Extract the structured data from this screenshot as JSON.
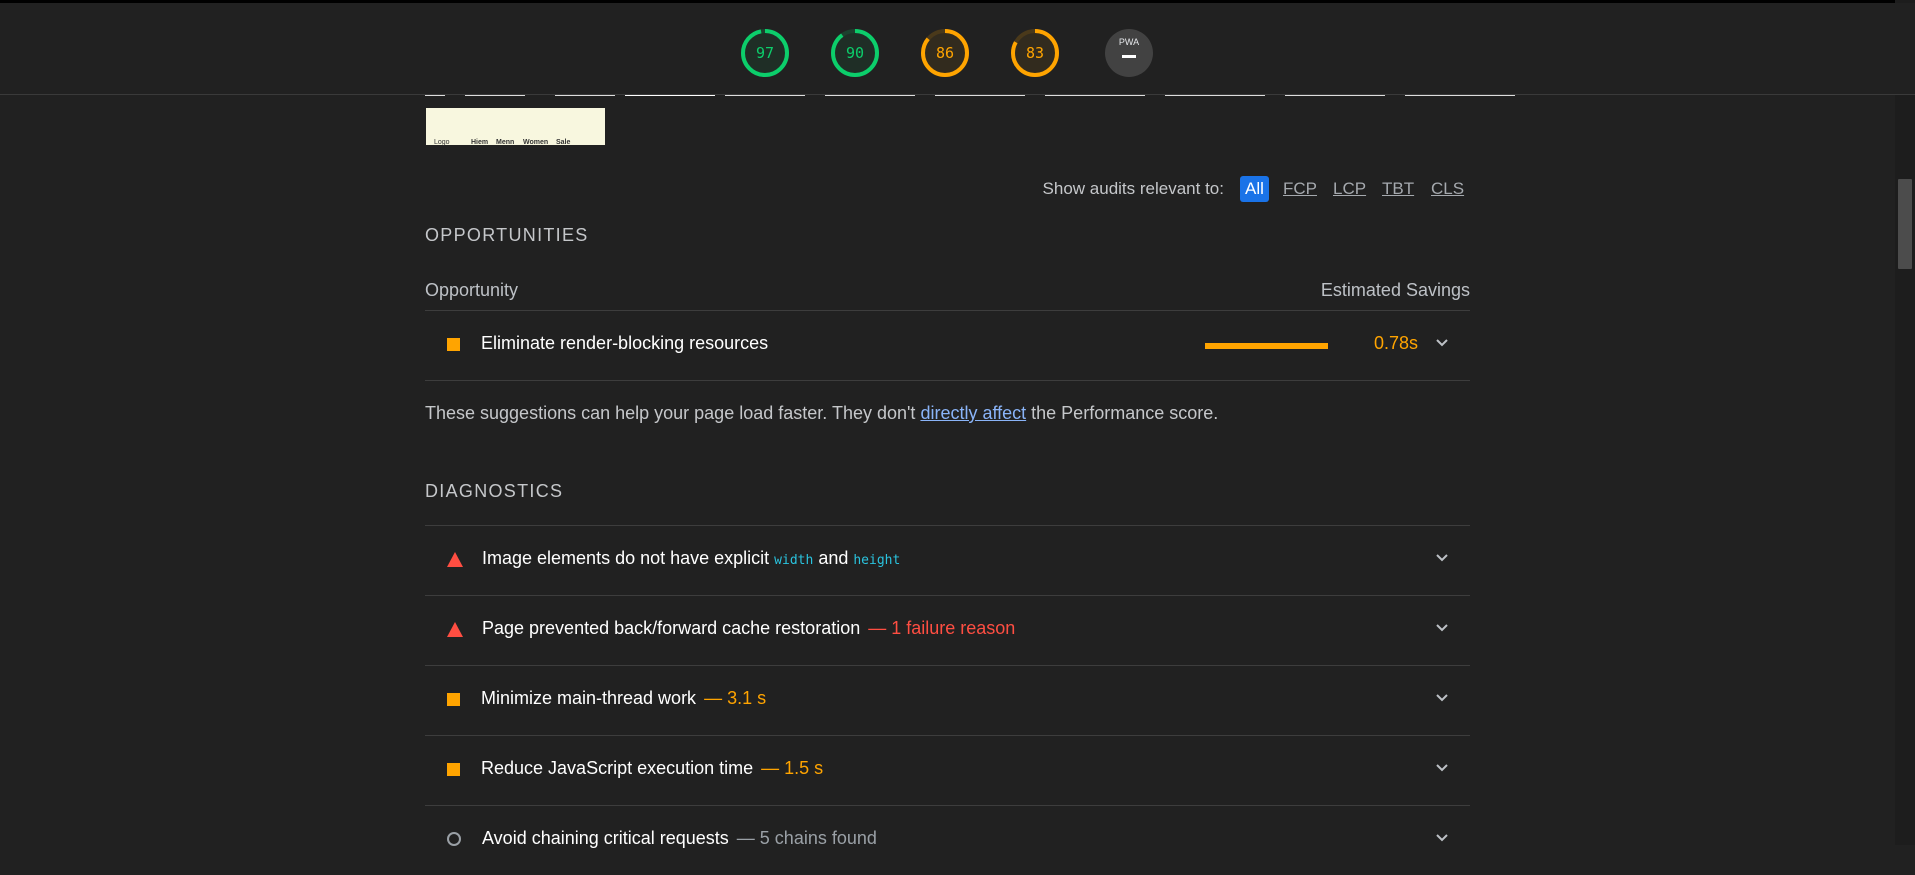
{
  "gauges": [
    {
      "label": "97",
      "score": 0.97,
      "color": "#0cce6b"
    },
    {
      "label": "90",
      "score": 0.9,
      "color": "#0cce6b"
    },
    {
      "label": "86",
      "score": 0.86,
      "color": "#ffa400"
    },
    {
      "label": "83",
      "score": 0.83,
      "color": "#ffa400"
    }
  ],
  "pwa_badge": {
    "label": "PWA"
  },
  "thumbnail": {
    "items": [
      "Logo",
      "Hiem",
      "Menn",
      "Women",
      "Sale"
    ]
  },
  "filter": {
    "label": "Show audits relevant to:",
    "options": [
      "All",
      "FCP",
      "LCP",
      "TBT",
      "CLS"
    ],
    "active": "All"
  },
  "opportunities": {
    "title": "OPPORTUNITIES",
    "col_left": "Opportunity",
    "col_right": "Estimated Savings",
    "items": [
      {
        "title": "Eliminate render-blocking resources",
        "savings": "0.78s",
        "bar_fraction": 1.0
      }
    ],
    "note_before": "These suggestions can help your page load faster. They don't ",
    "note_link": "directly affect",
    "note_after": " the Performance score."
  },
  "diagnostics": {
    "title": "DIAGNOSTICS",
    "items": [
      {
        "icon": "fail",
        "title_before": "Image elements do not have explicit ",
        "code1": "width",
        "mid": " and ",
        "code2": "height",
        "display": ""
      },
      {
        "icon": "fail",
        "title": "Page prevented back/forward cache restoration",
        "display": "— 1 failure reason"
      },
      {
        "icon": "average",
        "title": "Minimize main-thread work",
        "display": "— 3.1 s"
      },
      {
        "icon": "average",
        "title": "Reduce JavaScript execution time",
        "display": "— 1.5 s"
      },
      {
        "icon": "informative",
        "title": "Avoid chaining critical requests",
        "display": "— 5 chains found"
      }
    ]
  },
  "colors": {
    "pass": "#0cce6b",
    "average": "#ffa400",
    "fail": "#ff4e42",
    "accent": "#1a73e8"
  }
}
